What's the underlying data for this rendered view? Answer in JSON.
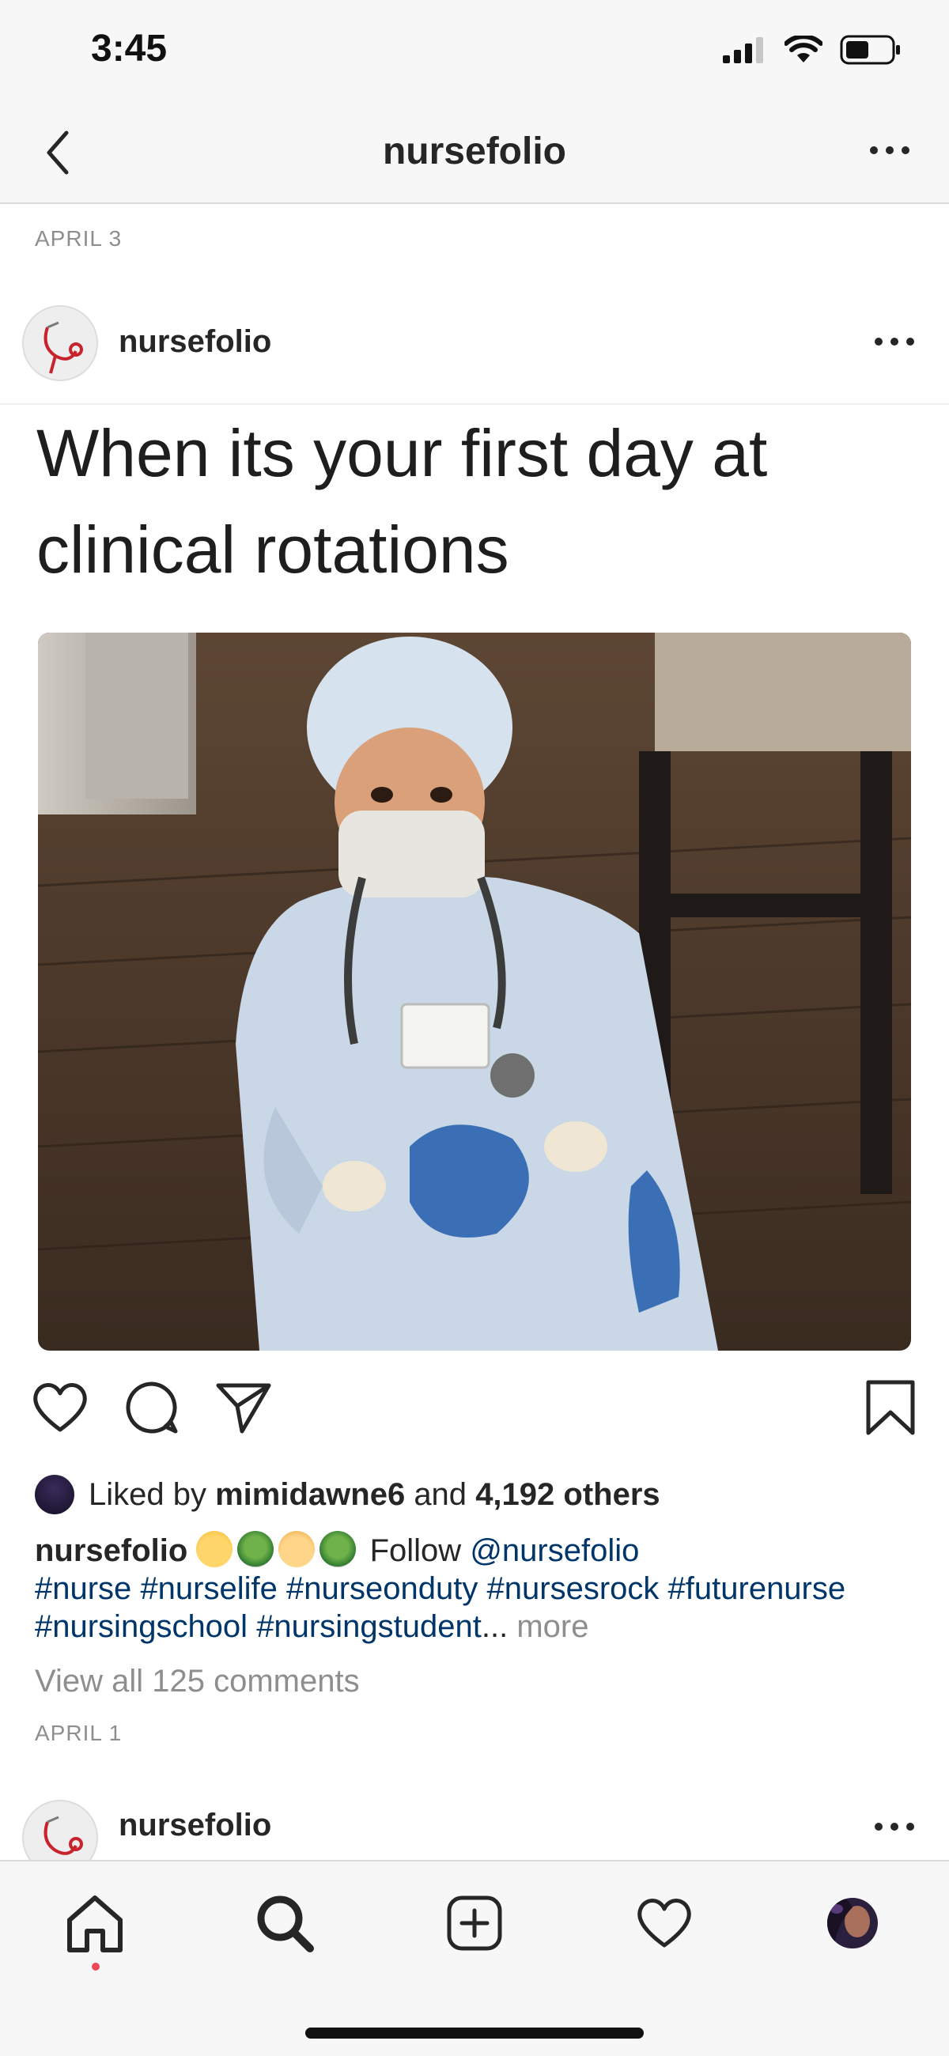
{
  "status_bar": {
    "time": "3:45"
  },
  "nav": {
    "title": "nursefolio"
  },
  "post": {
    "date": "APRIL 3",
    "username": "nursefolio",
    "meme_caption": "When its your first day at clinical rotations",
    "likes": {
      "prefix": "Liked by",
      "user": "mimidawne6",
      "connector": "and",
      "others": "4,192 others"
    },
    "caption": {
      "username": "nursefolio",
      "follow_text": "Follow",
      "mention": "@nursefolio",
      "hashtags": [
        "#nurse",
        "#nurselife",
        "#nurseonduty",
        "#nursesrock",
        "#futurenurse",
        "#nursingschool",
        "#nursingstudent"
      ],
      "ellipsis": "...",
      "more": "more"
    },
    "view_comments": "View all 125 comments",
    "post_date": "APRIL 1"
  },
  "next_post": {
    "username": "nursefolio"
  },
  "icons": {
    "back": "chevron-left-icon",
    "more": "more-horizontal-icon",
    "like": "heart-icon",
    "comment": "comment-icon",
    "share": "send-icon",
    "save": "bookmark-icon",
    "home": "home-icon",
    "search": "search-icon",
    "new_post": "plus-square-icon",
    "activity": "heart-icon",
    "profile": "avatar"
  },
  "colors": {
    "hashtag": "#003569",
    "notification_dot": "#ed4956",
    "muted": "#8e8e8e"
  }
}
